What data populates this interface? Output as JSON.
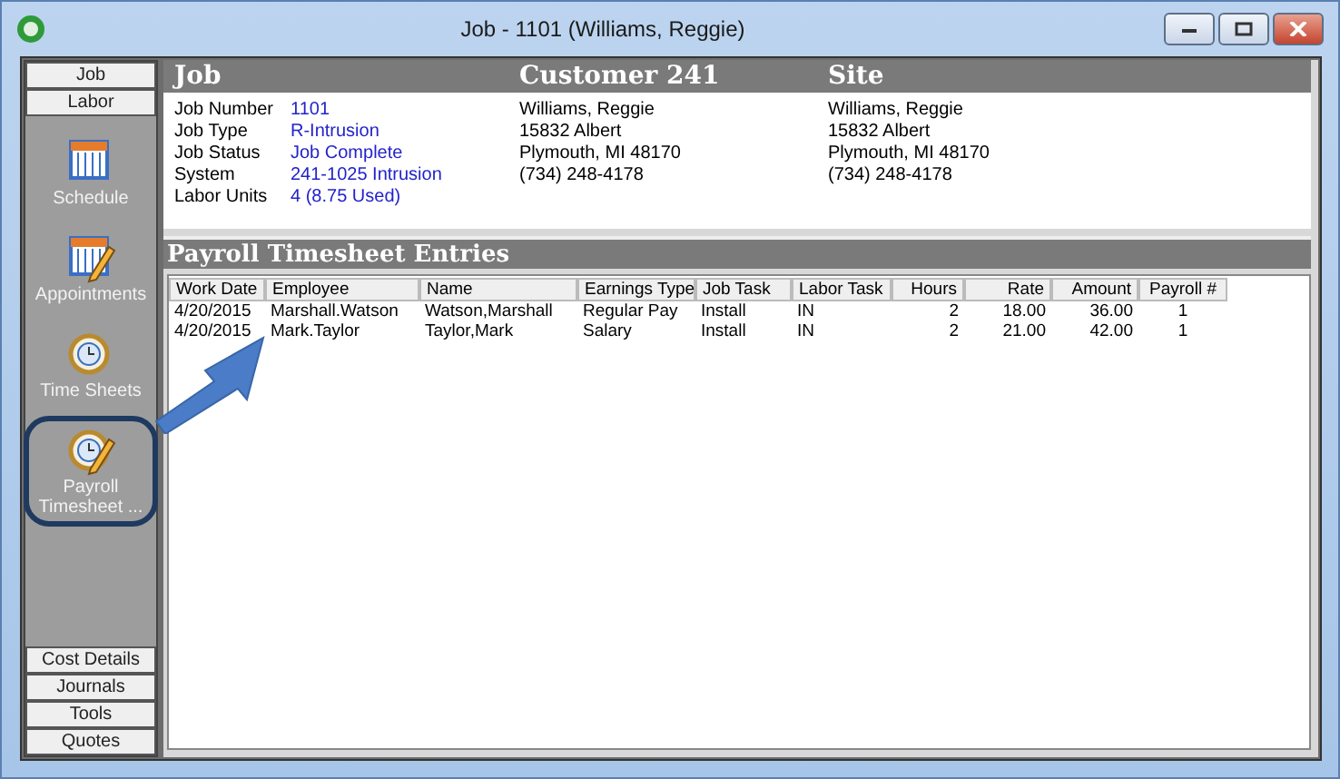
{
  "window": {
    "title": "Job - 1101 (Williams, Reggie)"
  },
  "sidebar": {
    "top_tabs": [
      "Job",
      "Labor"
    ],
    "items": [
      {
        "label": "Schedule",
        "highlighted": false
      },
      {
        "label": "Appointments",
        "highlighted": false
      },
      {
        "label": "Time Sheets",
        "highlighted": false
      },
      {
        "label": "Payroll Timesheet ...",
        "highlighted": true
      }
    ],
    "bottom_tabs": [
      "Cost Details",
      "Journals",
      "Tools",
      "Quotes"
    ]
  },
  "header": {
    "sections": [
      "Job",
      "Customer 241",
      "Site"
    ]
  },
  "job": [
    {
      "label": "Job Number",
      "value": "1101"
    },
    {
      "label": "Job Type",
      "value": "R-Intrusion"
    },
    {
      "label": "Job Status",
      "value": "Job Complete"
    },
    {
      "label": "System",
      "value": "241-1025 Intrusion"
    },
    {
      "label": "Labor Units",
      "value": "4 (8.75 Used)"
    }
  ],
  "customer": [
    "Williams, Reggie",
    "15832 Albert",
    "Plymouth, MI  48170",
    "(734) 248-4178"
  ],
  "site": [
    "Williams, Reggie",
    "15832 Albert",
    "Plymouth, MI  48170",
    "(734) 248-4178"
  ],
  "payroll": {
    "title": "Payroll Timesheet Entries",
    "columns": [
      "Work Date",
      "Employee",
      "Name",
      "Earnings Type",
      "Job Task",
      "Labor Task",
      "Hours",
      "Rate",
      "Amount",
      "Payroll #"
    ],
    "rows": [
      [
        "4/20/2015",
        "Marshall.Watson",
        "Watson,Marshall",
        "Regular Pay",
        "Install",
        "IN",
        "2",
        "18.00",
        "36.00",
        "1"
      ],
      [
        "4/20/2015",
        "Mark.Taylor",
        "Taylor,Mark",
        "Salary",
        "Install",
        "IN",
        "2",
        "21.00",
        "42.00",
        "1"
      ]
    ]
  }
}
